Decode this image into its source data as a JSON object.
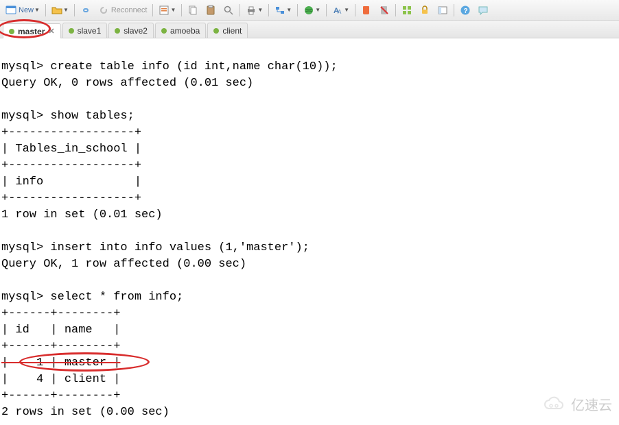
{
  "toolbar": {
    "new_label": "New",
    "reconnect_label": "Reconnect"
  },
  "tabs": [
    {
      "label": "master",
      "active": true
    },
    {
      "label": "slave1",
      "active": false
    },
    {
      "label": "slave2",
      "active": false
    },
    {
      "label": "amoeba",
      "active": false
    },
    {
      "label": "client",
      "active": false
    }
  ],
  "terminal_lines": [
    "mysql> create table info (id int,name char(10));",
    "Query OK, 0 rows affected (0.01 sec)",
    "",
    "mysql> show tables;",
    "+------------------+",
    "| Tables_in_school |",
    "+------------------+",
    "| info             |",
    "+------------------+",
    "1 row in set (0.01 sec)",
    "",
    "mysql> insert into info values (1,'master');",
    "Query OK, 1 row affected (0.00 sec)",
    "",
    "mysql> select * from info;",
    "+------+--------+",
    "| id   | name   |",
    "+------+--------+",
    "|    1 | master |",
    "|    4 | client |",
    "+------+--------+",
    "2 rows in set (0.00 sec)"
  ],
  "watermark": {
    "text": "亿速云"
  }
}
